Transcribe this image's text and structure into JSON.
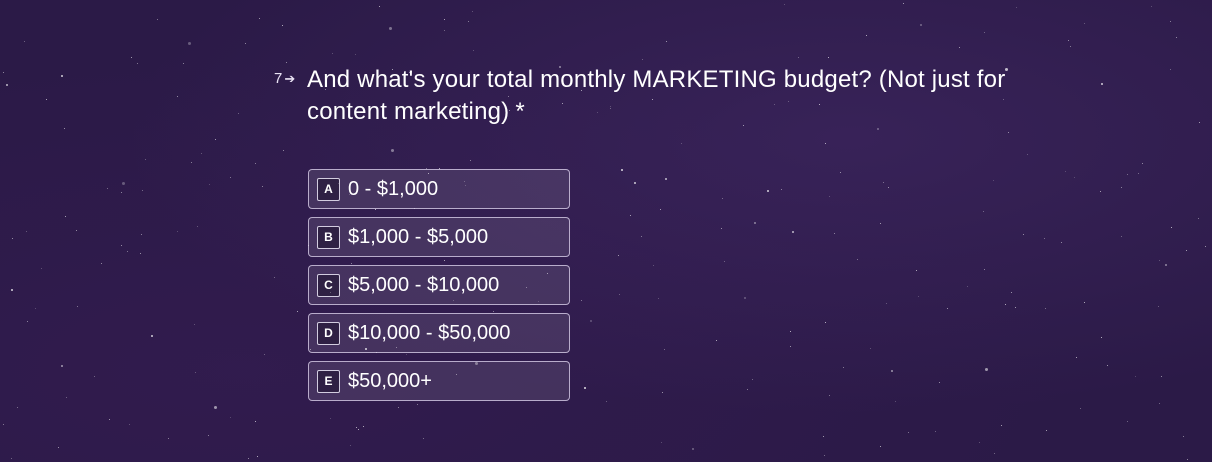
{
  "question": {
    "number": "7",
    "arrow_icon": "arrow-right-icon",
    "text": "And what's your total monthly MARKETING budget? (Not just for content marketing)",
    "required_mark": "*"
  },
  "choices": [
    {
      "key": "A",
      "label": "0 - $1,000"
    },
    {
      "key": "B",
      "label": "$1,000 - $5,000"
    },
    {
      "key": "C",
      "label": "$5,000 - $10,000"
    },
    {
      "key": "D",
      "label": "$10,000 - $50,000"
    },
    {
      "key": "E",
      "label": "$50,000+"
    }
  ],
  "colors": {
    "background": "#2b1a47",
    "text": "#ffffff",
    "choice_border": "#e6dcf5"
  }
}
